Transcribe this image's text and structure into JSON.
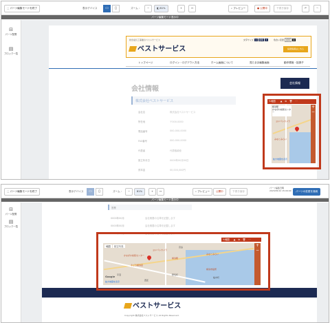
{
  "toolbar": {
    "exit_label": "パーツ編集モードを終了",
    "device_label": "表示デバイス",
    "zoom_label": "ズーム :",
    "zoom_value": "81",
    "zoom_unit": "%",
    "preview_label": "プレビュー",
    "publish_label": "公開中",
    "draft_label": "下書き保存",
    "save_label": "パーツの変更を適用",
    "update_date_label": "パーツ編集日時",
    "update_date": "2023/05/12 15:09:00"
  },
  "banner": {
    "text": "パーツ編集モード表示中"
  },
  "sidebar": {
    "items": [
      {
        "label": "パーツ配置"
      },
      {
        "label": "ブロック一覧"
      }
    ]
  },
  "site": {
    "tagline": "総合電気工事業のベストサービス",
    "brand": "ベストサービス",
    "brand_mark": "株式会社",
    "font_size_label": "文字サイズ",
    "size_small": "小",
    "size_std": "標準",
    "size_large": "大",
    "bg_color_label": "色合い変更",
    "bg_std": "標準",
    "bg_black": "黒",
    "cta": "採用情報はこちら",
    "nav": [
      "トップページ",
      "ログイン・ログアウト方法",
      "ホーム画面について",
      "見たまま編集画面",
      "動作環境・拡張子"
    ],
    "page_title": "会社情報",
    "side_button": "会社情報",
    "company_header": "株式会社ベストサービス",
    "rows": [
      {
        "k": "会社名",
        "v": "株式会社ベストサービス"
      },
      {
        "k": "所在地",
        "v": "〒000-0000"
      },
      {
        "k": "電話番号",
        "v": "000-000-0000"
      },
      {
        "k": "FAX番号",
        "v": "000-000-0000"
      },
      {
        "k": "代表者",
        "v": "代表取締役"
      },
      {
        "k": "設立年月日",
        "v": "0000年00月00日"
      },
      {
        "k": "資本金",
        "v": "00,000,000円"
      }
    ],
    "section2_label": "営業",
    "rows2": [
      {
        "k": "0000年00月",
        "v": "会社概要の沿革を記載します"
      },
      {
        "k": "0000年00月",
        "v": "会社概要の沿革を記載します"
      },
      {
        "k": "0000年00月",
        "v": "会社概要の沿革を記載します"
      }
    ],
    "footer_brand": "ベストサービス",
    "footer_brand_mark": "株式会社",
    "footer_copy": "Copyright 株式会社ベストサービス All Rights Reserved."
  },
  "map": {
    "part_label": "地図",
    "tab_map": "地図",
    "tab_satellite": "航空写真",
    "larger_map": "拡大地図を表示",
    "google": "Google",
    "zoom_in": "+",
    "zoom_out": "−",
    "pois": [
      "ヨドバシカメラ",
      "かながわ県民センター",
      "横浜駅",
      "みなとみらい",
      "そごう横浜店",
      "横浜市役所"
    ],
    "areas": [
      "高島",
      "平沼",
      "桜木町",
      "野毛町",
      "西区"
    ]
  },
  "colors": {
    "highlight": "#c0391b",
    "accent_blue": "#2f6db5",
    "brand_orange": "#e8a61b",
    "navy": "#1c2a52"
  }
}
